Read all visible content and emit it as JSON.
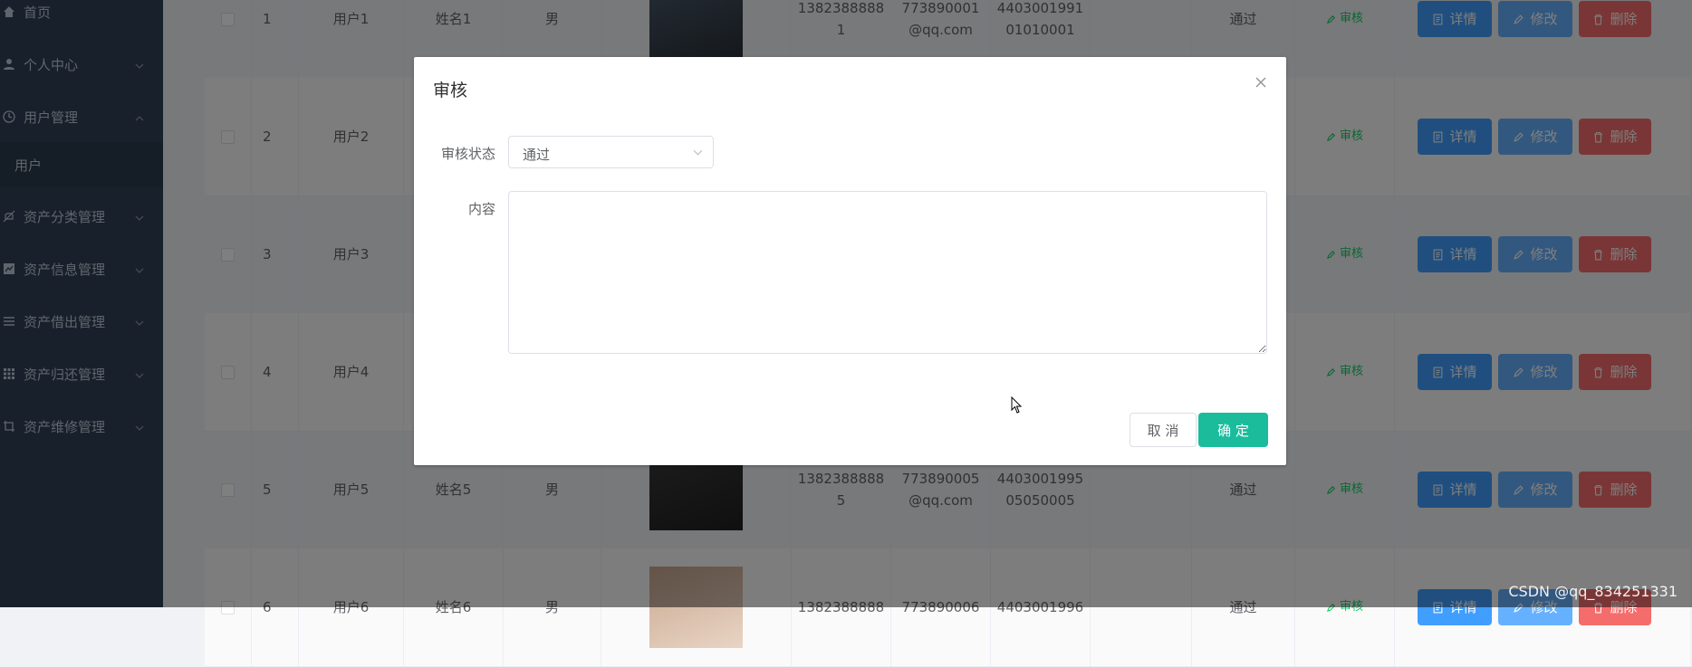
{
  "sidebar": {
    "items": [
      {
        "label": "首页",
        "icon": "home-icon"
      },
      {
        "label": "个人中心",
        "icon": "user-icon"
      },
      {
        "label": "用户管理",
        "icon": "clock-icon"
      },
      {
        "label": "用户",
        "icon": ""
      },
      {
        "label": "资产分类管理",
        "icon": "bell-off-icon"
      },
      {
        "label": "资产信息管理",
        "icon": "chart-icon"
      },
      {
        "label": "资产借出管理",
        "icon": "list-icon"
      },
      {
        "label": "资产归还管理",
        "icon": "grid-icon"
      },
      {
        "label": "资产维修管理",
        "icon": "crop-icon"
      }
    ]
  },
  "table": {
    "rows": [
      {
        "index": "1",
        "username": "用户1",
        "name": "姓名1",
        "gender": "男",
        "phone": "1382388888\n1",
        "email": "773890001\n@qq.com",
        "idcard": "4403001991\n01010001",
        "status": "通过"
      },
      {
        "index": "2",
        "username": "用户2",
        "name": "",
        "gender": "",
        "phone": "",
        "email": "",
        "idcard": "",
        "status": ""
      },
      {
        "index": "3",
        "username": "用户3",
        "name": "",
        "gender": "",
        "phone": "",
        "email": "",
        "idcard": "",
        "status": ""
      },
      {
        "index": "4",
        "username": "用户4",
        "name": "",
        "gender": "",
        "phone": "",
        "email": "",
        "idcard": "",
        "status": ""
      },
      {
        "index": "5",
        "username": "用户5",
        "name": "姓名5",
        "gender": "男",
        "phone": "1382388888\n5",
        "email": "773890005\n@qq.com",
        "idcard": "4403001995\n05050005",
        "status": "通过"
      },
      {
        "index": "6",
        "username": "用户6",
        "name": "姓名6",
        "gender": "男",
        "phone": "1382388888",
        "email": "773890006",
        "idcard": "4403001996",
        "status": "通过"
      }
    ],
    "audit_label": "审核",
    "detail_label": "详情",
    "edit_label": "修改",
    "delete_label": "删除"
  },
  "dialog": {
    "title": "审核",
    "status_label": "审核状态",
    "status_value": "通过",
    "content_label": "内容",
    "content_value": "",
    "cancel_label": "取 消",
    "ok_label": "确 定"
  },
  "watermark": "CSDN @qq_834251331",
  "colors": {
    "sidebar_bg": "#304156",
    "primary": "#409eff",
    "danger": "#f56c6c",
    "confirm": "#1abc9c",
    "audit": "#13ce66"
  }
}
